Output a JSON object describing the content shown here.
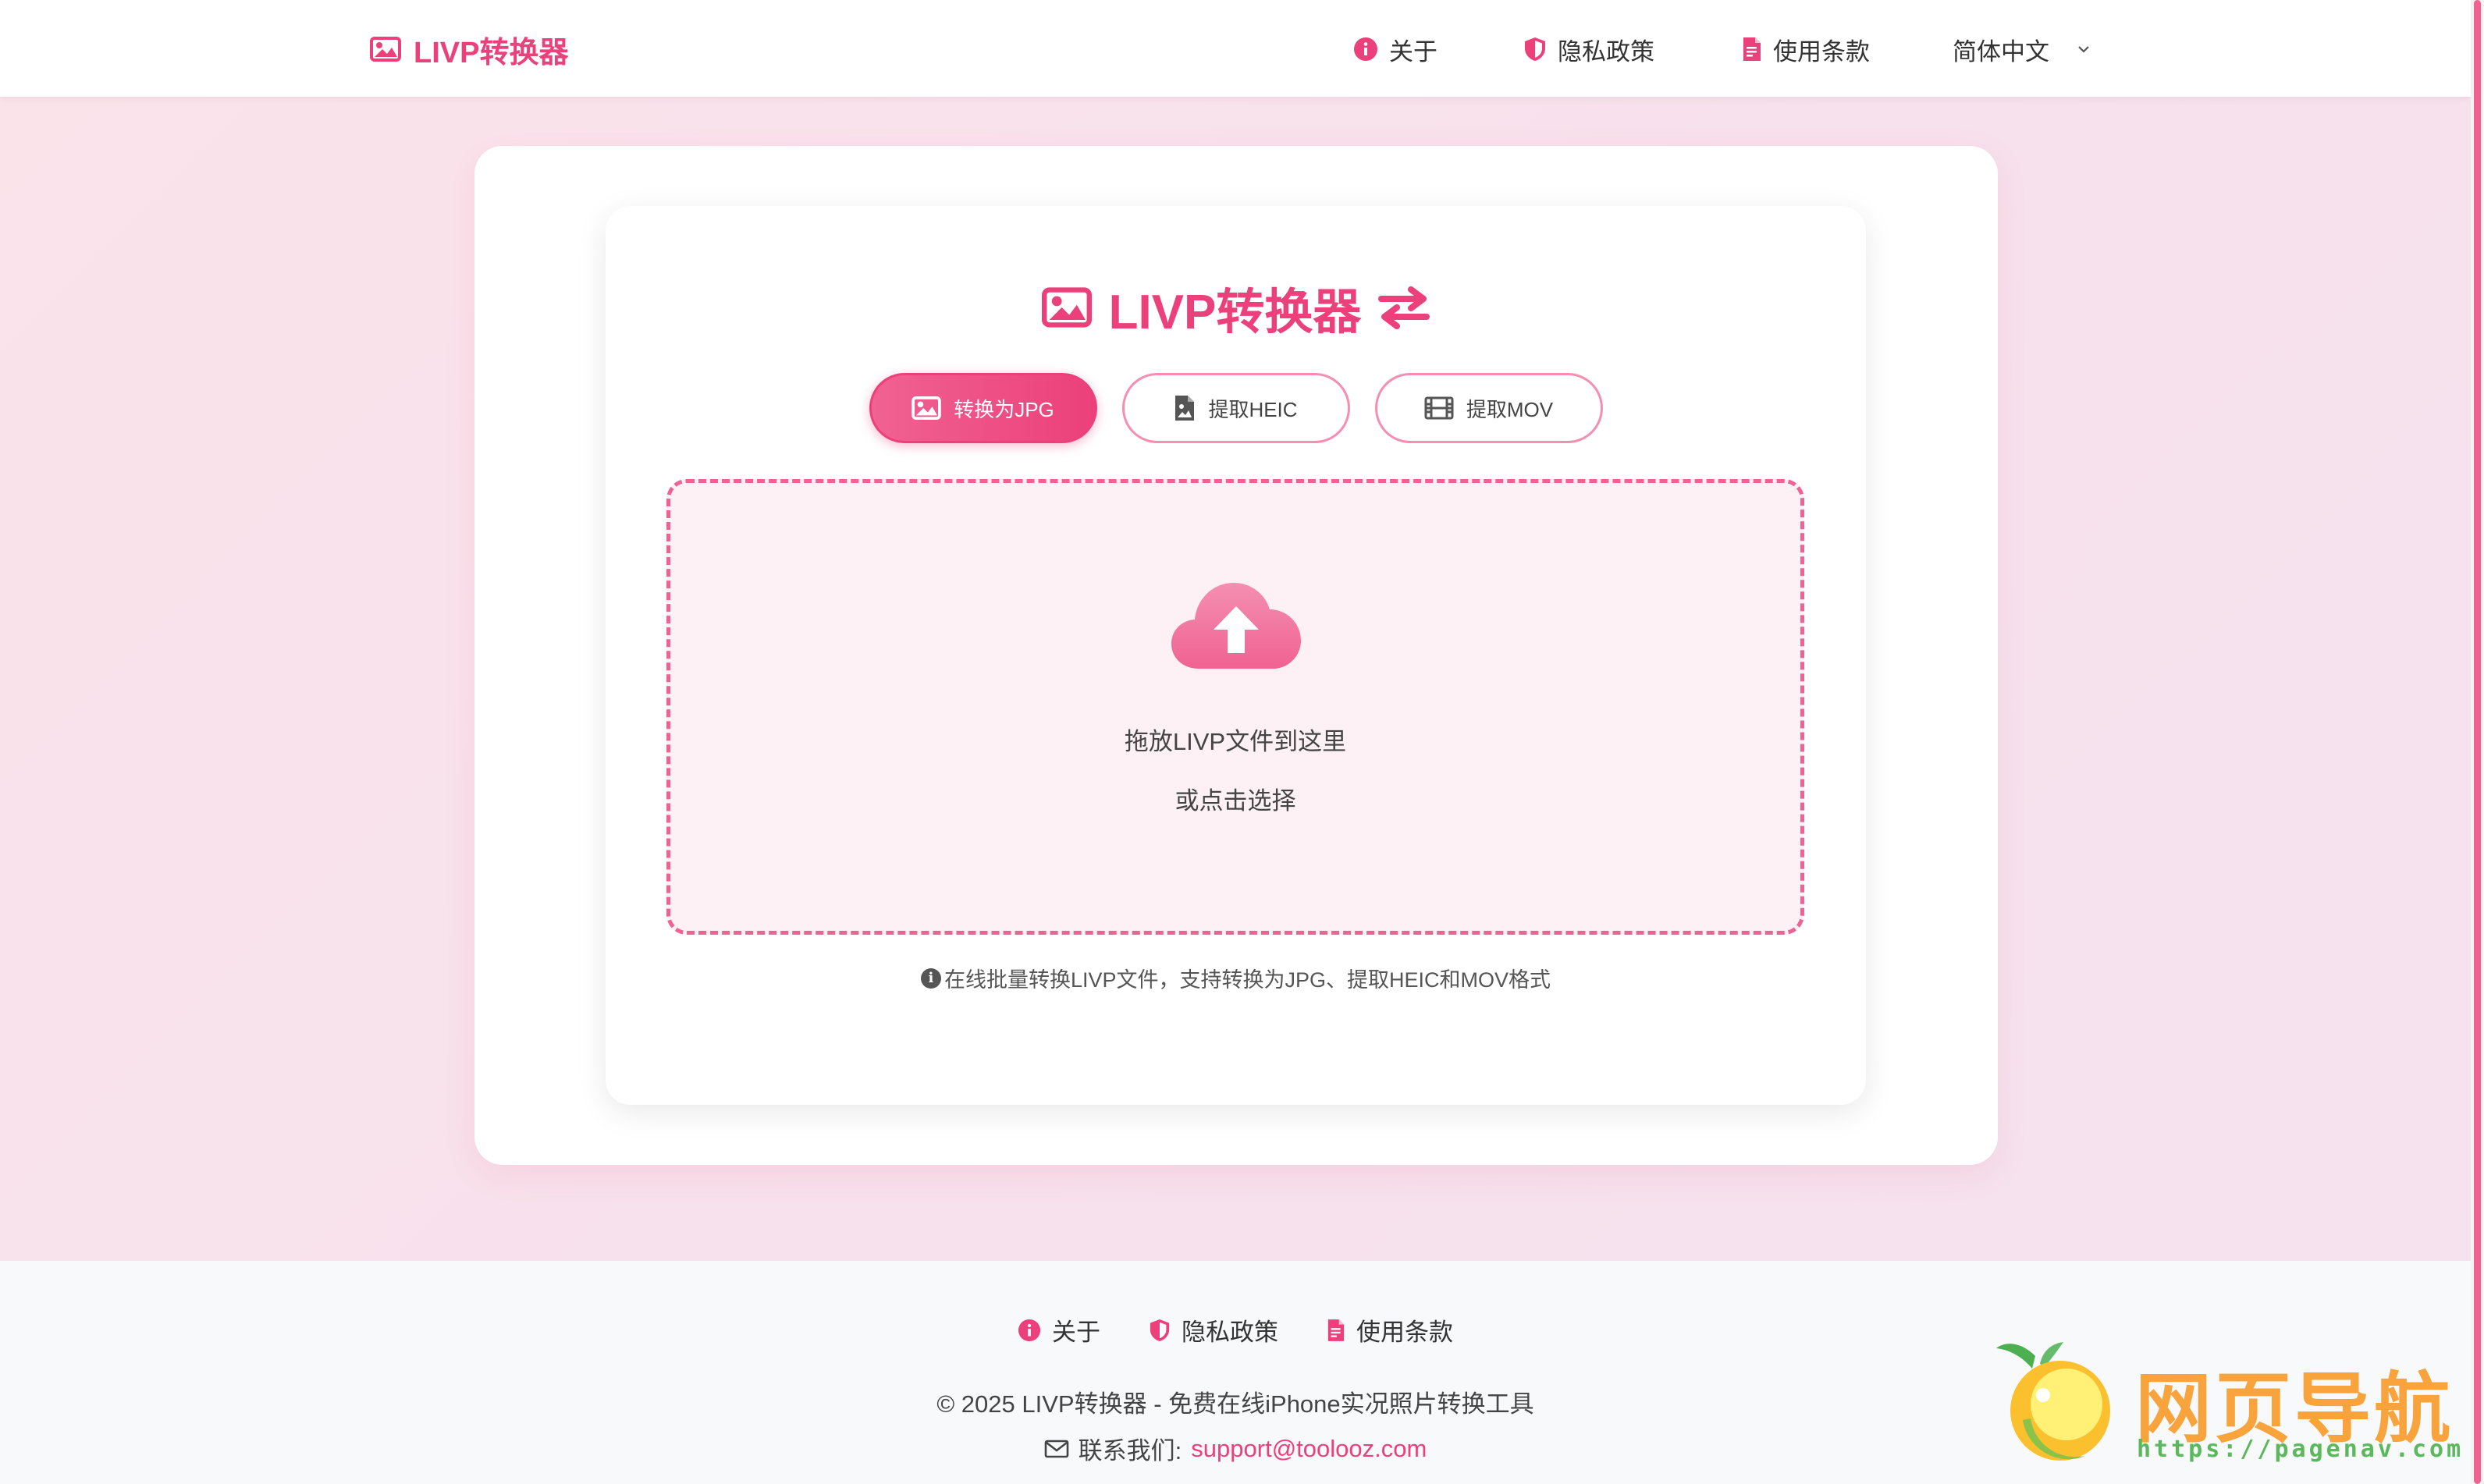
{
  "header": {
    "brand": "LIVP转换器",
    "nav": {
      "about": "关于",
      "privacy": "隐私政策",
      "terms": "使用条款",
      "language": "简体中文"
    }
  },
  "main": {
    "title": "LIVP转换器",
    "tabs": [
      {
        "label": "转换为JPG",
        "icon": "image-icon",
        "active": true
      },
      {
        "label": "提取HEIC",
        "icon": "file-image-icon",
        "active": false
      },
      {
        "label": "提取MOV",
        "icon": "film-icon",
        "active": false
      }
    ],
    "dropzone": {
      "primary": "拖放LIVP文件到这里",
      "secondary": "或点击选择",
      "icon": "cloud-upload-icon"
    },
    "hint": "在线批量转换LIVP文件，支持转换为JPG、提取HEIC和MOV格式"
  },
  "footer": {
    "links": {
      "about": "关于",
      "privacy": "隐私政策",
      "terms": "使用条款"
    },
    "copyright": "© 2025 LIVP转换器 - 免费在线iPhone实况照片转换工具",
    "contact_label": "联系我们:",
    "contact_email": "support@toolooz.com"
  },
  "watermark": {
    "text": "网页导航",
    "url": "https://pagenav.com"
  },
  "colors": {
    "accent": "#ec407a",
    "accent_light": "#f06292",
    "dropzone_bg": "#fdf1f5"
  }
}
